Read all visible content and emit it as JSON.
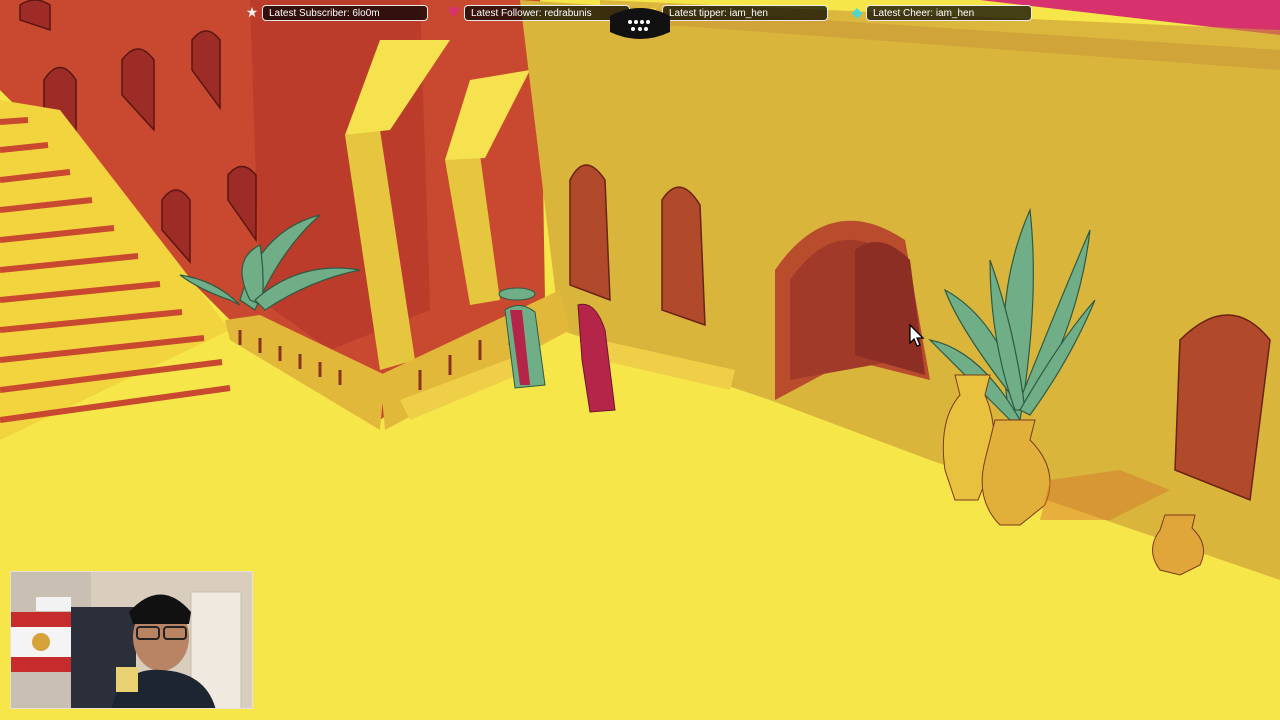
{
  "stream_overlay": {
    "subscriber": {
      "icon": "star-icon",
      "text": "Latest Subscriber: 6lo0m"
    },
    "follower": {
      "icon": "heart-icon",
      "text": "Latest Follower: redrabunis"
    },
    "tipper": {
      "icon": "coin-icon",
      "text": "Latest tipper: iam_hen"
    },
    "cheer": {
      "icon": "diamond-icon",
      "text": "Latest Cheer: iam_hen"
    }
  },
  "colors": {
    "floor": "#f6e64a",
    "wall_yellow": "#d9b53c",
    "wall_red": "#c8492f",
    "shadow_red": "#b0322d",
    "plant_green": "#6fae87",
    "robe_red": "#b52449",
    "overlay_pink": "#d8326e"
  },
  "game_scene": {
    "description_icons": [
      "staircase",
      "arched-windows",
      "balcony-railing",
      "plant",
      "character",
      "vases",
      "archway-door"
    ]
  }
}
